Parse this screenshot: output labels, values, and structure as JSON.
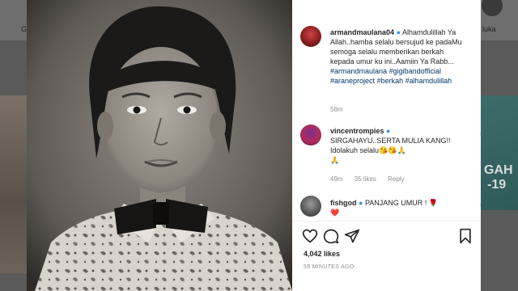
{
  "background": {
    "left_label": "G",
    "right_label": "luka",
    "right_thumb_line1": "GAH",
    "right_thumb_line2": "-19"
  },
  "post": {
    "author": "armandmaulana04",
    "caption_text": "Alhamdulillah Ya Allah..hamba selalu bersujud ke padaMu semoga selalu memberikan berkah kepada umur ku ini..Aamiin Ya Rabb...",
    "caption_tags": [
      "#armandmaulana",
      "#gigibandofficial",
      "#araneproject",
      "#berkah",
      "#alhamdulillah"
    ],
    "time": "58m"
  },
  "comments": [
    {
      "user": "vincentrompies",
      "text": "SIRGAHAYU..SERTA MULIA KANG!! Idolakuh selalu😘😘🙏",
      "extra_line": "🙏",
      "time": "49m",
      "likes": "35 likes",
      "reply": "Reply"
    },
    {
      "user": "fishgod",
      "text": "PANJANG UMUR ! 🌹",
      "extra_line": "❤️"
    }
  ],
  "likes_count": "4,042 likes",
  "time_ago": "58 MINUTES AGO",
  "colors": {
    "verified": "#3897f0",
    "hashtag": "#00376b",
    "heart_red": "#ed4956"
  },
  "icons": [
    "heart-icon",
    "comment-icon",
    "share-icon",
    "bookmark-icon"
  ]
}
